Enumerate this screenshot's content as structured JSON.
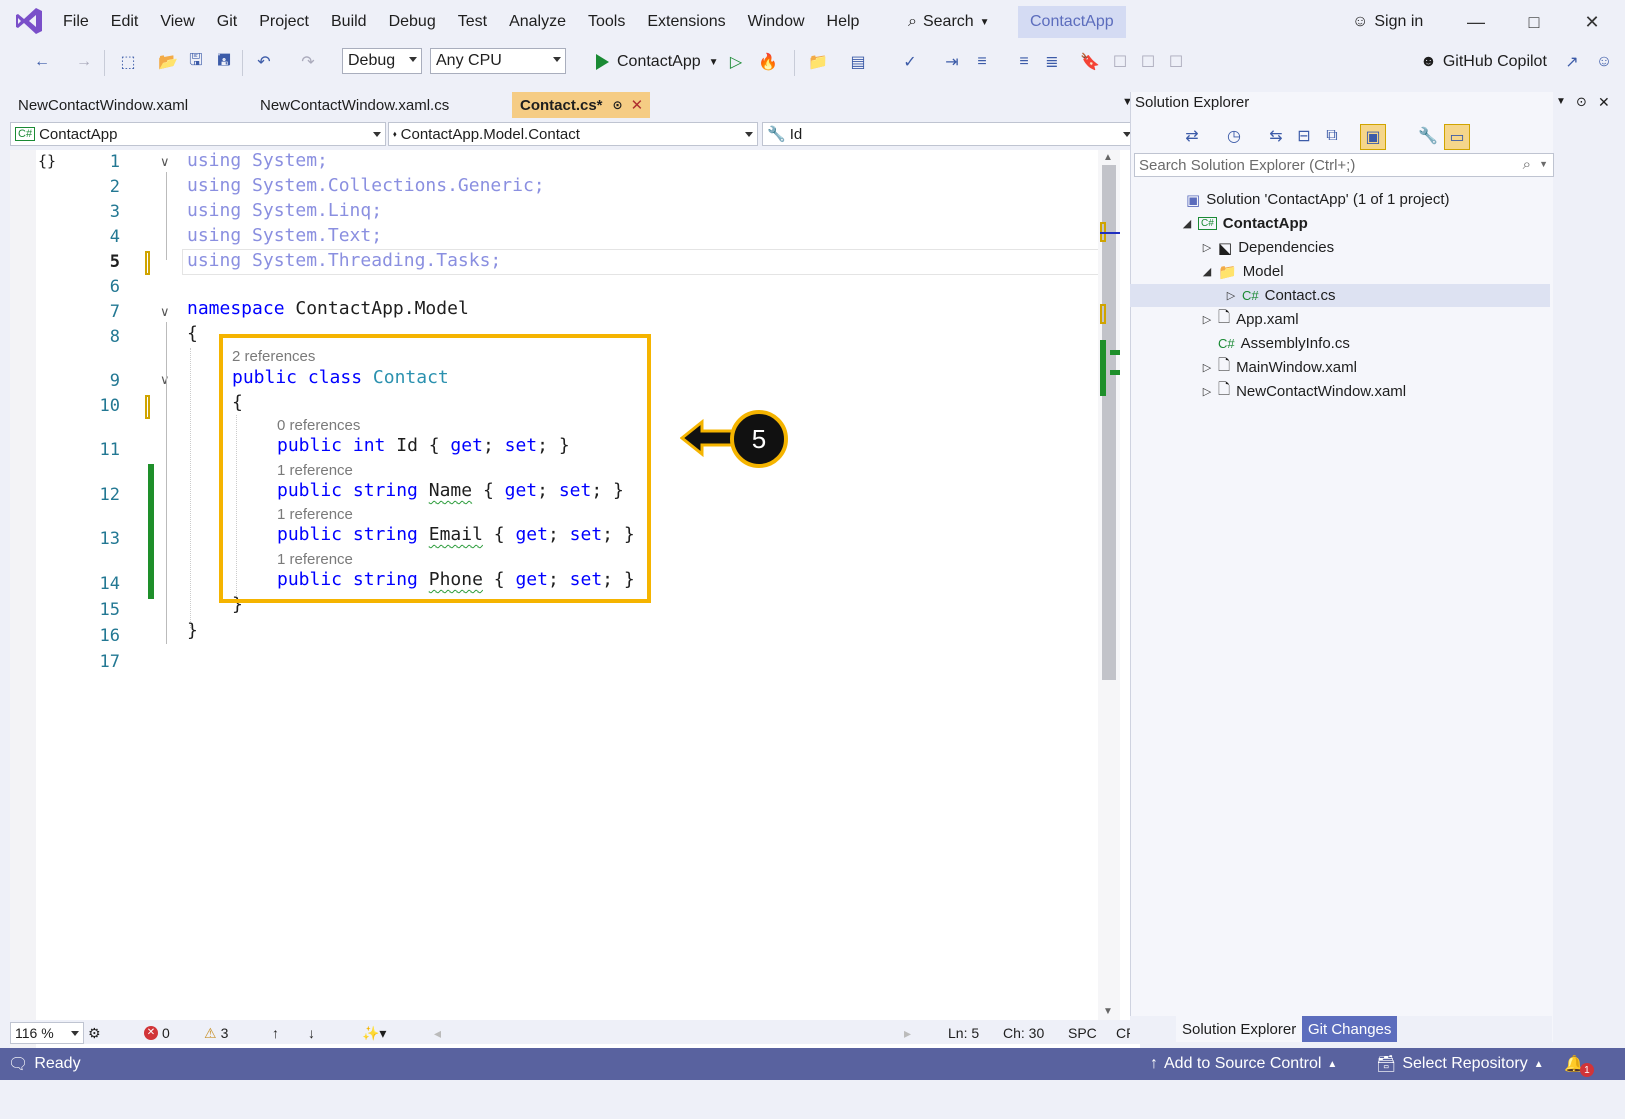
{
  "app": {
    "project_tab": "ContactApp"
  },
  "menu": [
    "File",
    "Edit",
    "View",
    "Git",
    "Project",
    "Build",
    "Debug",
    "Test",
    "Analyze",
    "Tools",
    "Extensions",
    "Window",
    "Help"
  ],
  "search_label": "Search",
  "sign_in": "Sign in",
  "toolbar": {
    "config": "Debug",
    "platform": "Any CPU",
    "run_target": "ContactApp",
    "copilot": "GitHub Copilot"
  },
  "tabs": [
    {
      "label": "NewContactWindow.xaml",
      "active": false
    },
    {
      "label": "NewContactWindow.xaml.cs",
      "active": false
    },
    {
      "label": "Contact.cs*",
      "active": true
    }
  ],
  "navbar": {
    "project": "ContactApp",
    "type": "ContactApp.Model.Contact",
    "member": "Id"
  },
  "code": {
    "lines": [
      {
        "n": "1",
        "text": "using System;"
      },
      {
        "n": "2",
        "text": "using System.Collections.Generic;"
      },
      {
        "n": "3",
        "text": "using System.Linq;"
      },
      {
        "n": "4",
        "text": "using System.Text;"
      },
      {
        "n": "5",
        "text": "using System.Threading.Tasks;"
      },
      {
        "n": "6",
        "text": ""
      },
      {
        "n": "7",
        "text": "namespace ContactApp.Model"
      },
      {
        "n": "8",
        "text": "{"
      },
      {
        "n": "9",
        "text": "public class Contact"
      },
      {
        "n": "10",
        "text": "{"
      },
      {
        "n": "11",
        "text": "public int Id { get; set; }"
      },
      {
        "n": "12",
        "text": "public string Name { get; set; }"
      },
      {
        "n": "13",
        "text": "public string Email { get; set; }"
      },
      {
        "n": "14",
        "text": "public string Phone { get; set; }"
      },
      {
        "n": "15",
        "text": "}"
      },
      {
        "n": "16",
        "text": "}"
      },
      {
        "n": "17",
        "text": ""
      }
    ],
    "lens": {
      "class": "2 references",
      "id": "0 references",
      "name": "1 reference",
      "email": "1 reference",
      "phone": "1 reference"
    }
  },
  "callout_number": "5",
  "editor_status": {
    "zoom": "116 %",
    "errors": "0",
    "warnings": "3",
    "line": "Ln: 5",
    "col": "Ch: 30",
    "spc": "SPC",
    "eol": "CRLF"
  },
  "solution_explorer": {
    "title": "Solution Explorer",
    "search_placeholder": "Search Solution Explorer (Ctrl+;)",
    "solution": "Solution 'ContactApp' (1 of 1 project)",
    "project": "ContactApp",
    "items": [
      "Dependencies",
      "Model",
      "Contact.cs",
      "App.xaml",
      "AssemblyInfo.cs",
      "MainWindow.xaml",
      "NewContactWindow.xaml"
    ],
    "bottom_tabs": [
      "Solution Explorer",
      "Git Changes"
    ]
  },
  "status_bar": {
    "ready": "Ready",
    "add_source": "Add to Source Control",
    "select_repo": "Select Repository",
    "notifications": "1"
  }
}
